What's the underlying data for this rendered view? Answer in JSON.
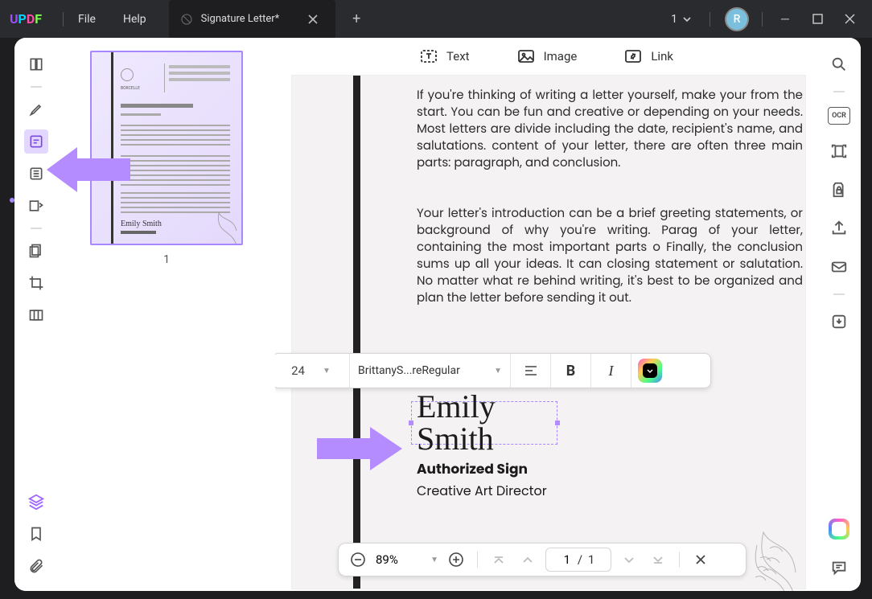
{
  "titlebar": {
    "menu_file": "File",
    "menu_help": "Help",
    "tab_title": "Signature Letter*",
    "page_counter": "1",
    "avatar_initial": "R"
  },
  "edit_tools": {
    "text": "Text",
    "image": "Image",
    "link": "Link"
  },
  "document": {
    "para1": "If you're thinking of writing a letter yourself, make your from the start. You can be fun and creative or depending on your needs. Most letters are divide including the date, recipient's name, and salutations. content of your letter, there are often three main parts: paragraph, and conclusion.",
    "para2": "Your letter's introduction can be a brief greeting statements, or background of why you're writing. Parag of your letter, containing the most important parts o Finally, the conclusion sums up all your ideas. It can closing statement or salutation. No matter what re behind writing, it's best to be organized and plan the letter before sending it out.",
    "signature": "Emily Smith",
    "auth_label": "Authorized Sign",
    "job_title": "Creative Art Director"
  },
  "font_popup": {
    "size": "24",
    "font_name": "BrittanyS...reRegular"
  },
  "zoom": {
    "percent": "89%",
    "page_current": "1",
    "page_total": "1"
  },
  "thumb": {
    "page_num": "1"
  },
  "ocr_label": "OCR"
}
